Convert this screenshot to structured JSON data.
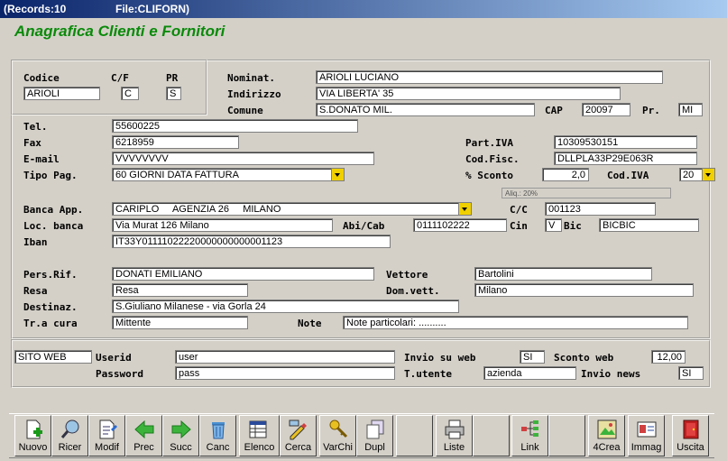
{
  "window": {
    "records": "(Records:10",
    "file": "File:CLIFORN)"
  },
  "heading": "Anagrafica Clienti e Fornitori",
  "header": {
    "codice_label": "Codice",
    "codice": "ARIOLI",
    "cf_label": "C/F",
    "cf": "C",
    "pr_label": "PR",
    "pr": "S",
    "nominat_label": "Nominat.",
    "nominat": "ARIOLI LUCIANO",
    "indirizzo_label": "Indirizzo",
    "indirizzo": "VIA LIBERTA' 35",
    "comune_label": "Comune",
    "comune": "S.DONATO MIL.",
    "cap_label": "CAP",
    "cap": "20097",
    "prov_label": "Pr.",
    "prov": "MI"
  },
  "main": {
    "tel_label": "Tel.",
    "tel": "55600225",
    "fax_label": "Fax",
    "fax": "6218959",
    "piva_label": "Part.IVA",
    "piva": "10309530151",
    "email_label": "E-mail",
    "email": "VVVVVVVV",
    "codfisc_label": "Cod.Fisc.",
    "codfisc": "DLLPLA33P29E063R",
    "tipopag_label": "Tipo Pag.",
    "tipopag": "60 GIORNI DATA FATTURA",
    "sconto_label": "% Sconto",
    "sconto": "2,0",
    "codiva_label": "Cod.IVA",
    "codiva": "20",
    "iva_note": "Aliq.: 20%",
    "banca_label": "Banca App.",
    "banca": "CARIPLO     AGENZIA 26     MILANO",
    "cc_label": "C/C",
    "cc": "001123",
    "locbanca_label": "Loc. banca",
    "locbanca": "Via Murat 126  Milano",
    "abicab_label": "Abi/Cab",
    "abicab": "0111102222",
    "cin_label": "Cin",
    "cin": "V",
    "bic_label": "Bic",
    "bic": "BICBIC",
    "iban_label": "Iban",
    "iban": "IT33Y01111022220000000000001123",
    "persrif_label": "Pers.Rif.",
    "persrif": "DONATI EMILIANO",
    "vettore_label": "Vettore",
    "vettore": "Bartolini",
    "resa_label": "Resa",
    "resa": "Resa",
    "domvett_label": "Dom.vett.",
    "domvett": "Milano",
    "destinaz_label": "Destinaz.",
    "destinaz": "S.Giuliano Milanese - via Gorla 24",
    "tracura_label": "Tr.a cura",
    "tracura": "Mittente",
    "note_label": "Note",
    "note": "Note particolari: .........."
  },
  "web": {
    "sito": "SITO WEB",
    "userid_label": "Userid",
    "userid": "user",
    "password_label": "Password",
    "password": "pass",
    "invio_label": "Invio su web",
    "invio": "SI",
    "sconto_web_label": "Sconto web",
    "sconto_web": "12,00",
    "tutente_label": "T.utente",
    "tutente": "azienda",
    "news_label": "Invio news",
    "news": "SI"
  },
  "toolbar": {
    "nuovo": "Nuovo",
    "ricer": "Ricer",
    "modif": "Modif",
    "prec": "Prec",
    "succ": "Succ",
    "canc": "Canc",
    "elenco": "Elenco",
    "cerca": "Cerca",
    "varchi": "VarChi",
    "dupl": "Dupl",
    "liste": "Liste",
    "link": "Link",
    "crea": "4Crea",
    "immag": "Immag",
    "uscita": "Uscita"
  }
}
